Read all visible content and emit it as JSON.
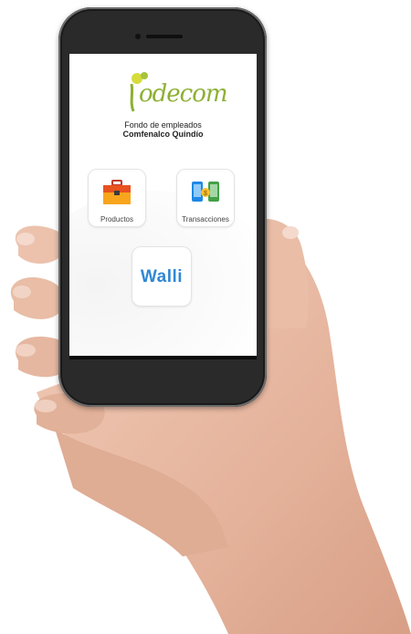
{
  "app": {
    "logo_text": "odecom",
    "org_line1": "Fondo de empleados",
    "org_line2": "Comfenalco Quindío"
  },
  "tiles": [
    {
      "label": "Productos",
      "icon": "toolbox-icon"
    },
    {
      "label": "Transacciones",
      "icon": "exchange-icon"
    }
  ],
  "walli": {
    "label": "Walli",
    "icon": "walli-logo"
  },
  "colors": {
    "brand_green": "#8db033",
    "brand_yellow": "#d6dc3a",
    "walli_blue": "#3187d4"
  }
}
